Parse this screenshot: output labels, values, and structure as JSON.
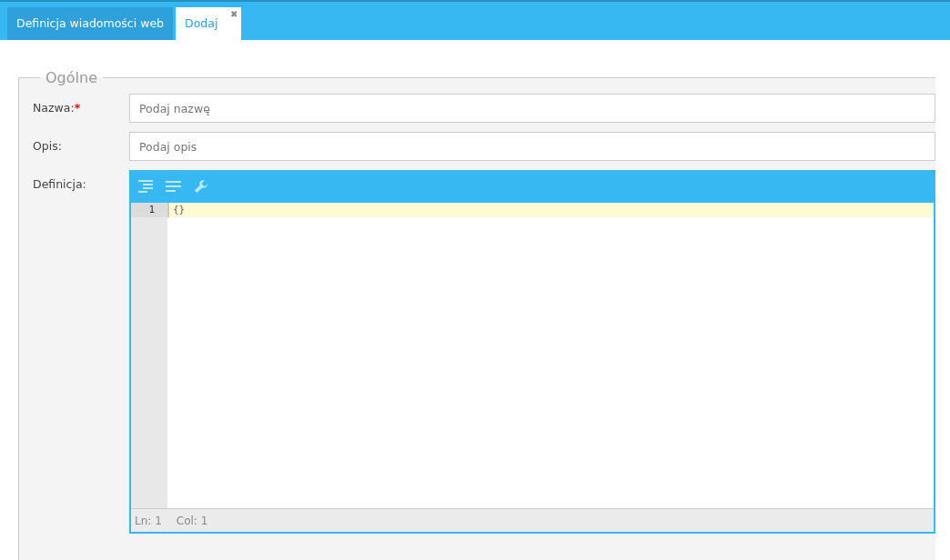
{
  "tabs": [
    {
      "label": "Definicja wiadomości web",
      "selected": false
    },
    {
      "label": "Dodaj",
      "selected": true,
      "close": "✖"
    }
  ],
  "form": {
    "legend": "Ogólne",
    "fields": [
      {
        "kind": "input",
        "label": "Nazwa:",
        "required_mark": "*",
        "placeholder": "Podaj nazwę"
      },
      {
        "kind": "input",
        "label": "Opis:",
        "placeholder": "Podaj opis"
      },
      {
        "kind": "editor",
        "label": "Definicja:",
        "lines": [
          {
            "number": "1",
            "text": "{}",
            "active": true
          }
        ],
        "status": [
          "Ln: 1",
          "Col: 1"
        ]
      }
    ]
  }
}
